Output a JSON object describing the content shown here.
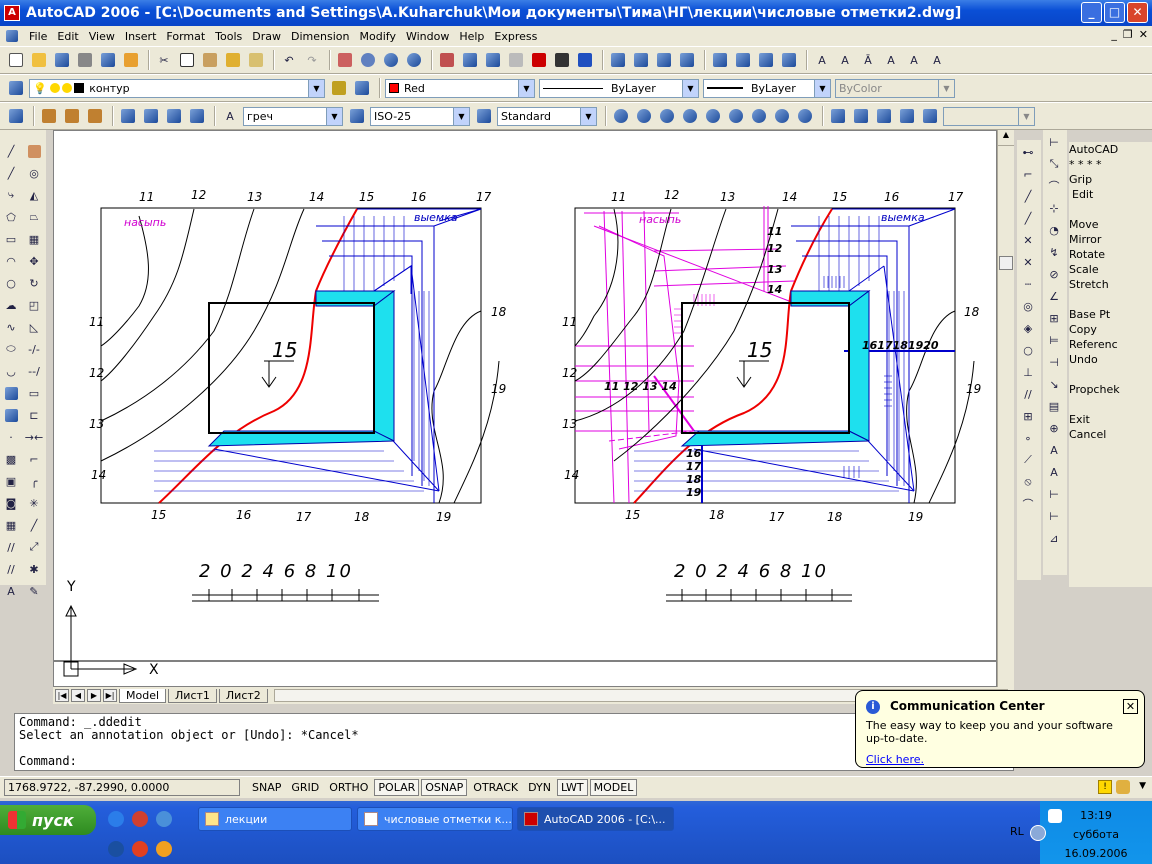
{
  "window": {
    "title": "AutoCAD 2006 - [C:\\Documents and Settings\\A.Kuharchuk\\Мои документы\\Тима\\НГ\\лекции\\числовые отметки2.dwg]"
  },
  "menu": [
    "File",
    "Edit",
    "View",
    "Insert",
    "Format",
    "Tools",
    "Draw",
    "Dimension",
    "Modify",
    "Window",
    "Help",
    "Express"
  ],
  "layers": {
    "layer_name": "контур",
    "color": "Red",
    "linetype": "ByLayer",
    "lineweight": "ByLayer",
    "plotstyle": "ByColor"
  },
  "styles": {
    "text_style": "греч",
    "dim_style": "ISO-25",
    "table_style": "Standard"
  },
  "right_menu": [
    "AutoCAD",
    "* * * *",
    "Grip",
    "Edit",
    "",
    "Move",
    "Mirror",
    "Rotate",
    "Scale",
    "Stretch",
    "",
    "Base Pt",
    "Copy",
    "Referenc",
    "Undo",
    "",
    "Propchek",
    "",
    "Exit",
    "Cancel"
  ],
  "drawing": {
    "left": {
      "top_labels": [
        "11",
        "12",
        "13",
        "14",
        "15",
        "16",
        "17"
      ],
      "left_labels": [
        "11",
        "12",
        "13",
        "14"
      ],
      "bottom_labels": [
        "15",
        "16",
        "17",
        "18",
        "19"
      ],
      "right_labels": [
        "18",
        "19"
      ],
      "embankment": "насыпь",
      "excavation": "выемка",
      "platform_elevation": "15"
    },
    "right": {
      "top_labels": [
        "11",
        "12",
        "13",
        "14",
        "15",
        "16",
        "17"
      ],
      "left_labels": [
        "11",
        "12",
        "13",
        "14"
      ],
      "bottom_labels": [
        "15",
        "18",
        "17",
        "18",
        "19"
      ],
      "right_labels": [
        "18",
        "19"
      ],
      "embankment": "насыпь",
      "excavation": "выемка",
      "platform_elevation": "15",
      "inner_stack": [
        "11",
        "12",
        "13",
        "14"
      ],
      "inner_row": "11 12 13 14",
      "side_row": "1617181920",
      "bottom_stack": [
        "16",
        "17",
        "18",
        "19"
      ]
    },
    "scale_text": "2 0 2 4 6 8 10",
    "ucs_x": "X",
    "ucs_y": "Y"
  },
  "tabs": [
    "Model",
    "Лист1",
    "Лист2"
  ],
  "command": {
    "line1": "Command: _.ddedit",
    "line2": "Select an annotation object or [Undo]: *Cancel*",
    "prompt": "Command:"
  },
  "status": {
    "coords": "1768.9722, -87.2990, 0.0000",
    "buttons": [
      "SNAP",
      "GRID",
      "ORTHO",
      "POLAR",
      "OSNAP",
      "OTRACK",
      "DYN",
      "LWT",
      "MODEL"
    ]
  },
  "balloon": {
    "title": "Communication Center",
    "text": "The easy way to keep you and your software up-to-date.",
    "link": "Click here."
  },
  "taskbar": {
    "start": "пуск",
    "tasks": [
      "лекции",
      "числовые отметки к...",
      "AutoCAD 2006 - [C:\\..."
    ],
    "lang": "RL",
    "time": "13:19",
    "day": "суббота",
    "date": "16.09.2006"
  }
}
